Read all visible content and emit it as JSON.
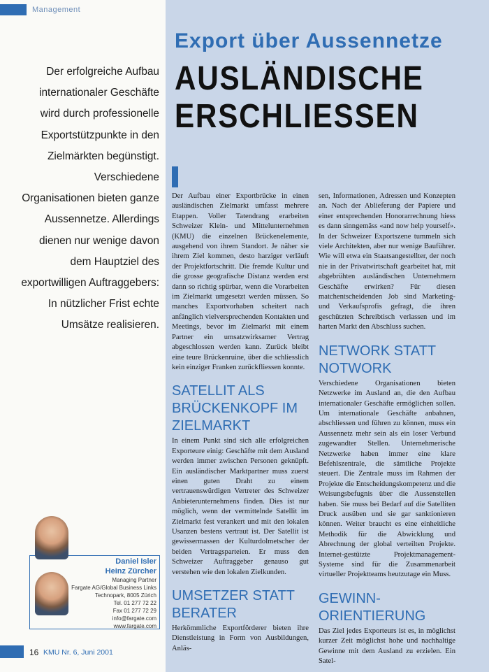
{
  "section": {
    "label": "Management"
  },
  "headline": "Export über Aussennetze",
  "title": {
    "line1": "AUSLÄNDISCHE",
    "line2": "ERSCHLIESSEN"
  },
  "lead": "Der erfolgreiche Aufbau internationaler Geschäfte wird durch professionelle Exportstützpunkte in den Zielmärkten begünstigt. Verschiedene Organisationen bieten ganze Aussennetze. Allerdings dienen nur wenige davon dem Hauptziel des exportwilligen Auftraggebers: In nützlicher Frist echte Umsätze realisieren.",
  "body": {
    "intro": "Der Aufbau einer Exportbrücke in einen ausländischen Zielmarkt umfasst mehrere Etappen. Voller Tatendrang erarbeiten Schweizer Klein- und Mittelunternehmen (KMU) die einzelnen Brückenelemente, ausgehend von ihrem Standort. Je näher sie ihrem Ziel kommen, desto harziger verläuft der Projektfortschritt. Die fremde Kultur und die grosse geografische Distanz werden erst dann so richtig spürbar, wenn die Vorarbeiten im Zielmarkt umgesetzt werden müssen. So manches Exportvorhaben scheitert nach anfänglich vielversprechenden Kontakten und Meetings, bevor im Zielmarkt mit einem Partner ein umsatzwirksamer Vertrag abgeschlossen werden kann. Zurück bleibt eine teure Brückenruine, über die schliesslich kein einziger Franken zurückfliessen konnte.",
    "h1": "SATELLIT ALS BRÜCKENKOPF IM ZIELMARKT",
    "p1": "In einem Punkt sind sich alle erfolgreichen Exporteure einig: Geschäfte mit dem Ausland werden immer zwischen Personen geknüpft. Ein ausländischer Marktpartner muss zuerst einen guten Draht zu einem vertrauenswürdigen Vertreter des Schweizer Anbieterunternehmens finden. Dies ist nur möglich, wenn der vermittelnde Satellit im Zielmarkt fest verankert und mit den lokalen Usanzen bestens vertraut ist. Der Satellit ist gewissermassen der Kulturdolmetscher der beiden Vertragsparteien. Er muss den Schweizer Auftraggeber genauso gut verstehen wie den lokalen Zielkunden.",
    "h2": "UMSETZER STATT BERATER",
    "p2": "Herkömmliche Exportförderer bieten ihre Dienstleistung in Form von Ausbildungen, Anläs-",
    "c2p0": "sen, Informationen, Adressen und Konzepten an. Nach der Ablieferung der Papiere und einer entsprechenden Honorarrechnung hiess es dann sinngemäss «and now help yourself». In der Schweizer Exportszene tummeln sich viele Architekten, aber nur wenige Bauführer. Wie will etwa ein Staatsangestellter, der noch nie in der Privatwirtschaft gearbeitet hat, mit abgebrühten ausländischen Unternehmern Geschäfte erwirken? Für diesen matchentscheidenden Job sind Marketing- und Verkaufsprofis gefragt, die ihren geschützten Schreibtisch verlassen und im harten Markt den Abschluss suchen.",
    "h3": "NETWORK STATT NOTWORK",
    "p3": "Verschiedene Organisationen bieten Netzwerke im Ausland an, die den Aufbau internationaler Geschäfte ermöglichen sollen. Um internationale Geschäfte anbahnen, abschliessen und führen zu können, muss ein Aussennetz mehr sein als ein loser Verbund zugewandter Stellen. Unternehmerische Netzwerke haben immer eine klare Befehlszentrale, die sämtliche Projekte steuert. Die Zentrale muss im Rahmen der Projekte die Entscheidungskompetenz und die Weisungsbefugnis über die Aussenstellen haben. Sie muss bei Bedarf auf die Satelliten Druck ausüben und sie gar sanktionieren können. Weiter braucht es eine einheitliche Methodik für die Abwicklung und Abrechnung der global verteilten Projekte. Internet-gestützte Projektmanagement-Systeme sind für die Zusammenarbeit virtueller Projektteams heutzutage ein Muss.",
    "h4": "GEWINN-ORIENTIERUNG",
    "p4": "Das Ziel jedes Exporteurs ist es, in möglichst kurzer Zeit möglichst hohe und nachhaltige Gewinne mit dem Ausland zu erzielen. Ein Satel-"
  },
  "authors": {
    "name1": "Daniel Isler",
    "name2": "Heinz Zürcher",
    "role": "Managing Partner",
    "company": "Fargate AG/Global Business Links",
    "address": "Technopark, 8005 Zürich",
    "tel": "Tel. 01 277 72 22",
    "fax": "Fax 01 277 72 29",
    "email": "info@fargate.com",
    "web": "www.fargate.com"
  },
  "footer": {
    "page": "16",
    "issue": "KMU Nr. 6, Juni 2001"
  },
  "colors": {
    "accent": "#2f6db3",
    "panel": "#c9d6e8"
  }
}
